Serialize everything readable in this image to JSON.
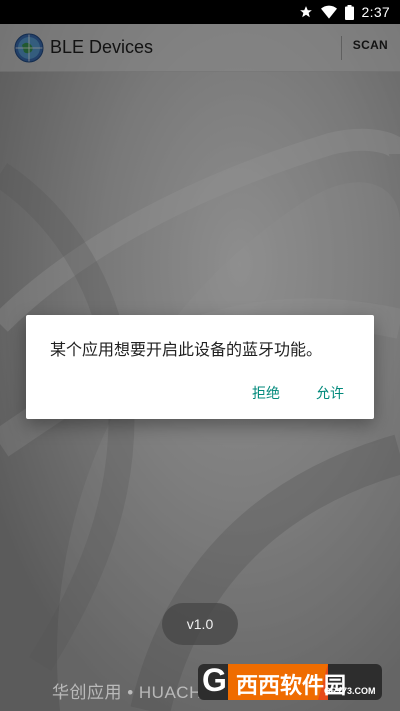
{
  "status_bar": {
    "time": "2:37",
    "icons": [
      "star-icon",
      "wifi-icon",
      "battery-icon"
    ]
  },
  "app_bar": {
    "title": "BLE Devices",
    "action_label": "SCAN",
    "logo_icon": "globe-logo-icon"
  },
  "dialog": {
    "message": "某个应用想要开启此设备的蓝牙功能。",
    "deny_label": "拒绝",
    "allow_label": "允许",
    "accent_color": "#00897b"
  },
  "version_label": "v1.0",
  "footer_text": "华创应用 • HUACHUANG",
  "watermark": {
    "logo_letter": "G",
    "brand_text": "西西软件园",
    "url_text": "CR173.COM"
  }
}
